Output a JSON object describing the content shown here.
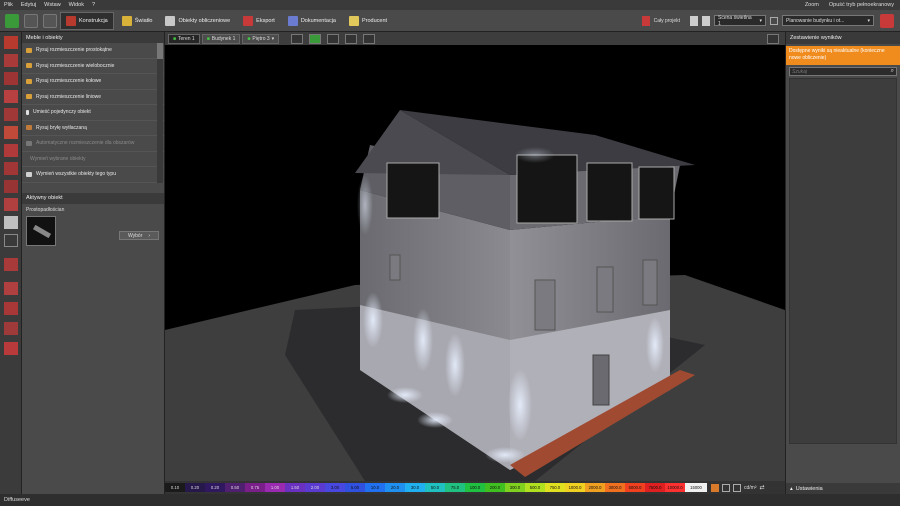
{
  "menu": {
    "items": [
      "Plik",
      "Edytuj",
      "Wstaw",
      "Widok",
      "?"
    ],
    "zoom": "Zoom",
    "quit_label": "Opuść tryb pełnoekranowy"
  },
  "toolbar": {
    "tabs": [
      {
        "label": "Konstrukcja",
        "color": "#b83a2e"
      },
      {
        "label": "Światło",
        "color": "#d9b23a"
      },
      {
        "label": "Obiekty obliczeniowe",
        "color": "#c8c8c8"
      },
      {
        "label": "Eksport",
        "color": "#c83a3a"
      },
      {
        "label": "Dokumentacja",
        "color": "#6a7bd0"
      },
      {
        "label": "Producent",
        "color": "#e0c85a"
      }
    ],
    "project_label": "Cały projekt",
    "scene_select": "Scena świetlna 1",
    "planning_select": "Planowanie budynku i ot..."
  },
  "left_panel": {
    "header": "Meble i obiekty",
    "items": [
      {
        "label": "Rysuj rozmieszczenie prostokątne",
        "enabled": true
      },
      {
        "label": "Rysuj rozmieszczenie wielobocznie",
        "enabled": true
      },
      {
        "label": "Rysuj rozmieszczenie kołowe",
        "enabled": true
      },
      {
        "label": "Rysuj rozmieszczenie liniowe",
        "enabled": true
      },
      {
        "label": "Umieść pojedynczy obiekt",
        "enabled": true
      },
      {
        "label": "Rysuj bryłę wytłaczaną",
        "enabled": true
      },
      {
        "label": "Automatyczne rozmieszczenie dla obszarów",
        "enabled": false
      },
      {
        "label": "Wymień wybrane obiekty",
        "enabled": false
      },
      {
        "label": "Wymień wszystkie obiekty tego typu",
        "enabled": true
      }
    ],
    "active_header": "Aktywny obiekt",
    "active_name": "Prostopadłościan",
    "choose_button": "Wybór"
  },
  "view_tabs": {
    "tabs": [
      {
        "label": "Teren 1",
        "active": true
      },
      {
        "label": "Budynek 1",
        "active": false
      },
      {
        "label": "Piętro 3",
        "active": false
      }
    ]
  },
  "legend": {
    "values": [
      "0.10",
      "0.20",
      "0.20",
      "0.50",
      "0.75",
      "1.00",
      "1.50",
      "2.00",
      "3.00",
      "5.00",
      "10.0",
      "20.0",
      "30.0",
      "50.0",
      "75.0",
      "100.0",
      "200.0",
      "300.0",
      "500.0",
      "750.0",
      "1000.0",
      "2000.0",
      "3000.0",
      "5000.0",
      "7500.0",
      "10000.0",
      "15000"
    ],
    "colors": [
      "#1a1a1a",
      "#26184a",
      "#301860",
      "#502070",
      "#7a1e8a",
      "#9a2ab0",
      "#6a30c0",
      "#5a3ad0",
      "#4848e0",
      "#3050e0",
      "#2070f0",
      "#2090f0",
      "#20b0f0",
      "#20c0c0",
      "#20c080",
      "#20c040",
      "#40c020",
      "#80d020",
      "#b0e020",
      "#e0e020",
      "#f0d020",
      "#f0a020",
      "#f07020",
      "#f04020",
      "#e02020",
      "#ff3030",
      "#f0f0f0"
    ],
    "unit": "cd/m²"
  },
  "right_panel": {
    "header": "Zestawienie wyników",
    "notice": "Dostępne wyniki są nieaktualne (konieczne nowe obliczenie)",
    "notice_color": "#f08c1e",
    "search_placeholder": "Szukaj",
    "footer": "Ustawienia"
  },
  "status": {
    "text": "Diffuseeve"
  }
}
